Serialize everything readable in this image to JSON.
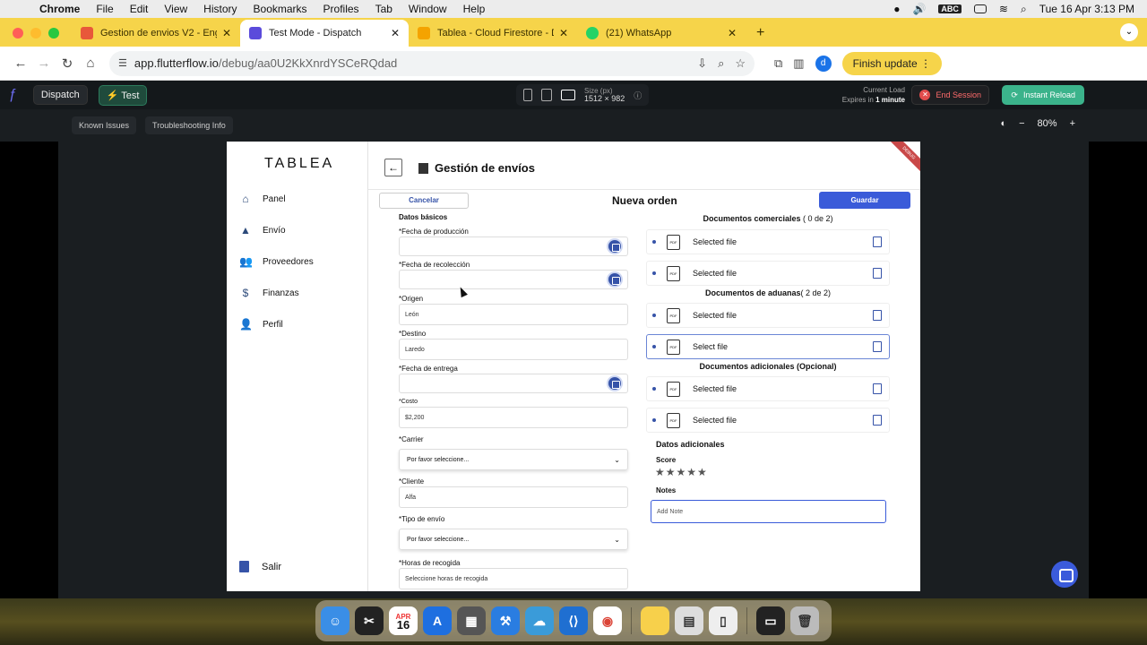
{
  "menubar": {
    "apple": "",
    "app": "Chrome",
    "items": [
      "File",
      "Edit",
      "View",
      "History",
      "Bookmarks",
      "Profiles",
      "Tab",
      "Window",
      "Help"
    ],
    "input_source": "ABC",
    "clock": "Tue 16 Apr  3:13 PM"
  },
  "tabs": [
    {
      "title": "Gestion de envios V2 - English",
      "color": "#e8583a"
    },
    {
      "title": "Test Mode - Dispatch",
      "color": "#5b4bdb"
    },
    {
      "title": "Tablea - Cloud Firestore - Dat",
      "color": "#f4a300"
    },
    {
      "title": "(21) WhatsApp",
      "color": "#25d366"
    }
  ],
  "toolbar": {
    "url_host": "app.flutterflow.io",
    "url_path": "/debug/aa0U2KkXnrdYSCeRQdad",
    "profile_initial": "d",
    "finish_update": "Finish update"
  },
  "flutterflow": {
    "project": "Dispatch",
    "mode": "Test",
    "size_label": "Size (px)",
    "size_value": "1512 × 982",
    "current_load": "Current Load",
    "expires_prefix": "Expires in",
    "expires_value": "1 minute",
    "end_session": "End Session",
    "instant_reload": "Instant Reload",
    "known_issues": "Known Issues",
    "troubleshooting": "Troubleshooting Info",
    "zoom": "80%"
  },
  "app": {
    "brand": "TABLEA",
    "nav": [
      "Panel",
      "Envío",
      "Proveedores",
      "Finanzas",
      "Perfil"
    ],
    "logout": "Salir",
    "header_title": "Gestión de envíos",
    "ribbon": "DEBUG",
    "cancel": "Cancelar",
    "new_order": "Nueva orden",
    "save": "Guardar",
    "basic_data": "Datos básicos",
    "fields": {
      "production_date": {
        "label": "*Fecha de producción",
        "value": ""
      },
      "pickup_date": {
        "label": "*Fecha de recolección",
        "value": ""
      },
      "origin": {
        "label": "*Origen",
        "value": "León"
      },
      "destination": {
        "label": "*Destino",
        "value": "Laredo"
      },
      "delivery_date": {
        "label": "*Fecha de entrega",
        "value": ""
      },
      "cost": {
        "label": "*Costo",
        "value": "$2,200"
      },
      "carrier": {
        "label": "*Carrier",
        "value": "Por favor seleccione..."
      },
      "client": {
        "label": "*Cliente",
        "value": "Alfa"
      },
      "shipping_type": {
        "label": "*Tipo de envío",
        "value": "Por favor seleccione..."
      },
      "pickup_hours": {
        "label": "*Horas de recogida",
        "value": "Seleccione horas de recogida"
      }
    },
    "docs": {
      "commercial_title": "Documentos comerciales",
      "commercial_count": "( 0 de 2)",
      "customs_title": "Documentos de aduanas",
      "customs_count": "( 2 de 2)",
      "additional_title": "Documentos adicionales (Opcional)",
      "rows": [
        "Selected file",
        "Selected file",
        "Selected file",
        "Select file",
        "Selected file",
        "Selected file"
      ]
    },
    "extra": {
      "title": "Datos adicionales",
      "score_label": "Score",
      "stars": "★★★★★",
      "score_value": 0,
      "notes_label": "Notes",
      "notes_placeholder": "Add Note"
    }
  },
  "dock": {
    "calendar_month": "APR",
    "calendar_day": "16"
  }
}
